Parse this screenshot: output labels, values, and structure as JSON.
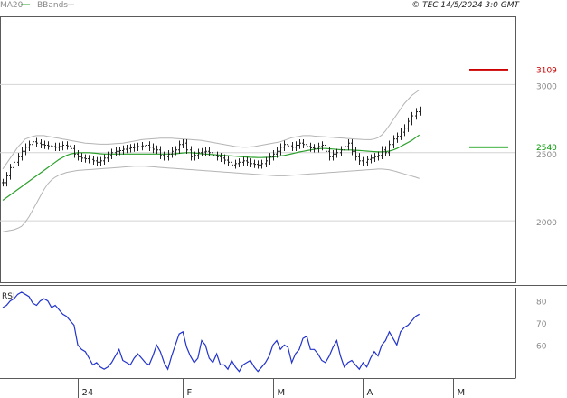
{
  "header": {
    "legend_items": [
      {
        "label": "MA20",
        "color": "#2ca02c"
      },
      {
        "label": "BBands",
        "color": "#c8c8c8"
      }
    ],
    "copyright": "© TEC 14/5/2024 3:0 GMT"
  },
  "colors": {
    "bg": "#ffffff",
    "grid": "#d4d4d4",
    "frame": "#5a5a5a",
    "candle": "#222222",
    "ma": "#2ca02c",
    "bbands": "#b4b4b4",
    "rsi": "#2233cc",
    "resistance": "#cc0000",
    "support": "#009900"
  },
  "chart_data": [
    {
      "type": "candlestick",
      "title": "",
      "x_tick_labels": [
        "24",
        "F",
        "M",
        "A",
        "M"
      ],
      "x_tick_index": [
        20,
        48,
        72,
        96,
        120
      ],
      "y_tick_labels": [
        "3000",
        "2500",
        "2000"
      ],
      "y_ticks": [
        3000,
        2500,
        2000
      ],
      "ylim": [
        1550,
        3500
      ],
      "grid": true,
      "levels": [
        {
          "name": "resistance",
          "value": 3109,
          "label": "3109",
          "color": "#cc0000"
        },
        {
          "name": "support",
          "value": 2540,
          "label": "2540",
          "color": "#009900"
        }
      ],
      "close": [
        2280,
        2330,
        2390,
        2430,
        2470,
        2510,
        2540,
        2560,
        2580,
        2570,
        2560,
        2555,
        2550,
        2545,
        2540,
        2545,
        2555,
        2550,
        2530,
        2490,
        2470,
        2460,
        2455,
        2450,
        2440,
        2430,
        2440,
        2460,
        2480,
        2500,
        2510,
        2515,
        2525,
        2530,
        2535,
        2540,
        2545,
        2550,
        2555,
        2540,
        2525,
        2520,
        2480,
        2470,
        2490,
        2510,
        2520,
        2560,
        2570,
        2520,
        2470,
        2480,
        2500,
        2505,
        2510,
        2500,
        2480,
        2470,
        2460,
        2445,
        2430,
        2410,
        2420,
        2430,
        2440,
        2430,
        2420,
        2415,
        2410,
        2420,
        2440,
        2470,
        2490,
        2510,
        2540,
        2560,
        2550,
        2540,
        2555,
        2570,
        2560,
        2545,
        2535,
        2530,
        2545,
        2555,
        2510,
        2470,
        2490,
        2500,
        2520,
        2545,
        2570,
        2510,
        2470,
        2440,
        2430,
        2450,
        2460,
        2470,
        2480,
        2520,
        2500,
        2560,
        2600,
        2620,
        2650,
        2680,
        2730,
        2770,
        2800,
        2810
      ],
      "ma20": [
        2150,
        2170,
        2190,
        2210,
        2230,
        2250,
        2270,
        2290,
        2310,
        2330,
        2350,
        2370,
        2390,
        2410,
        2430,
        2450,
        2465,
        2480,
        2490,
        2495,
        2500,
        2500,
        2500,
        2500,
        2498,
        2495,
        2492,
        2490,
        2490,
        2490,
        2490,
        2490,
        2490,
        2490,
        2490,
        2490,
        2490,
        2490,
        2490,
        2490,
        2490,
        2490,
        2490,
        2490,
        2490,
        2490,
        2492,
        2495,
        2498,
        2500,
        2500,
        2498,
        2495,
        2492,
        2490,
        2488,
        2486,
        2484,
        2482,
        2480,
        2478,
        2476,
        2474,
        2472,
        2470,
        2468,
        2466,
        2465,
        2464,
        2464,
        2465,
        2466,
        2468,
        2472,
        2476,
        2480,
        2486,
        2492,
        2498,
        2505,
        2510,
        2515,
        2520,
        2525,
        2528,
        2530,
        2530,
        2528,
        2526,
        2524,
        2522,
        2520,
        2520,
        2520,
        2518,
        2516,
        2514,
        2512,
        2510,
        2508,
        2506,
        2506,
        2508,
        2512,
        2520,
        2530,
        2545,
        2560,
        2575,
        2590,
        2610,
        2630
      ],
      "bb_upper": [
        2380,
        2420,
        2460,
        2500,
        2540,
        2570,
        2600,
        2610,
        2620,
        2625,
        2625,
        2625,
        2620,
        2615,
        2610,
        2605,
        2600,
        2595,
        2590,
        2585,
        2580,
        2575,
        2570,
        2568,
        2566,
        2564,
        2562,
        2562,
        2562,
        2564,
        2566,
        2568,
        2570,
        2575,
        2580,
        2585,
        2590,
        2595,
        2598,
        2600,
        2602,
        2604,
        2606,
        2606,
        2606,
        2606,
        2604,
        2602,
        2600,
        2598,
        2596,
        2594,
        2592,
        2590,
        2585,
        2580,
        2575,
        2570,
        2565,
        2560,
        2555,
        2550,
        2545,
        2542,
        2540,
        2540,
        2542,
        2545,
        2550,
        2555,
        2560,
        2565,
        2570,
        2575,
        2580,
        2590,
        2600,
        2610,
        2615,
        2620,
        2625,
        2625,
        2625,
        2622,
        2620,
        2618,
        2616,
        2614,
        2612,
        2610,
        2608,
        2606,
        2604,
        2602,
        2600,
        2598,
        2596,
        2595,
        2595,
        2600,
        2610,
        2630,
        2660,
        2700,
        2740,
        2780,
        2820,
        2860,
        2890,
        2920,
        2940,
        2960
      ],
      "bb_lower": [
        1920,
        1925,
        1930,
        1935,
        1945,
        1960,
        1990,
        2030,
        2080,
        2130,
        2180,
        2230,
        2270,
        2300,
        2320,
        2335,
        2345,
        2355,
        2360,
        2365,
        2370,
        2372,
        2374,
        2376,
        2378,
        2380,
        2382,
        2384,
        2386,
        2388,
        2390,
        2392,
        2394,
        2396,
        2398,
        2400,
        2400,
        2400,
        2400,
        2398,
        2396,
        2394,
        2392,
        2390,
        2388,
        2386,
        2384,
        2382,
        2380,
        2378,
        2376,
        2374,
        2372,
        2370,
        2368,
        2366,
        2364,
        2362,
        2360,
        2358,
        2356,
        2354,
        2352,
        2350,
        2348,
        2346,
        2344,
        2342,
        2340,
        2338,
        2336,
        2334,
        2332,
        2330,
        2330,
        2330,
        2332,
        2334,
        2336,
        2338,
        2340,
        2342,
        2344,
        2346,
        2348,
        2350,
        2352,
        2354,
        2356,
        2358,
        2360,
        2362,
        2364,
        2366,
        2368,
        2370,
        2372,
        2374,
        2376,
        2378,
        2380,
        2380,
        2378,
        2374,
        2368,
        2360,
        2352,
        2344,
        2336,
        2328,
        2320,
        2310
      ]
    },
    {
      "type": "line",
      "title": "RSI",
      "x_tick_labels": [
        "24",
        "F",
        "M",
        "A",
        "M"
      ],
      "y_tick_labels": [
        "80",
        "70",
        "60"
      ],
      "y_ticks": [
        80,
        70,
        60
      ],
      "ylim": [
        45,
        86
      ],
      "series": [
        {
          "name": "RSI",
          "values": [
            77,
            78,
            80,
            81,
            83,
            84,
            83,
            82,
            79,
            78,
            80,
            81,
            80,
            77,
            78,
            76,
            74,
            73,
            71,
            69,
            60,
            58,
            57,
            54,
            51,
            52,
            50,
            49,
            50,
            52,
            55,
            58,
            53,
            52,
            51,
            54,
            56,
            54,
            52,
            51,
            55,
            60,
            57,
            52,
            49,
            55,
            60,
            65,
            66,
            59,
            55,
            52,
            54,
            62,
            60,
            54,
            52,
            56,
            51,
            51,
            49,
            53,
            50,
            48,
            51,
            52,
            53,
            50,
            48,
            50,
            52,
            55,
            60,
            62,
            58,
            60,
            59,
            52,
            56,
            58,
            63,
            64,
            58,
            58,
            56,
            53,
            52,
            55,
            59,
            62,
            55,
            50,
            52,
            53,
            51,
            49,
            52,
            50,
            54,
            57,
            55,
            60,
            62,
            66,
            63,
            60,
            66,
            68,
            69,
            71,
            73,
            74
          ]
        }
      ]
    }
  ]
}
